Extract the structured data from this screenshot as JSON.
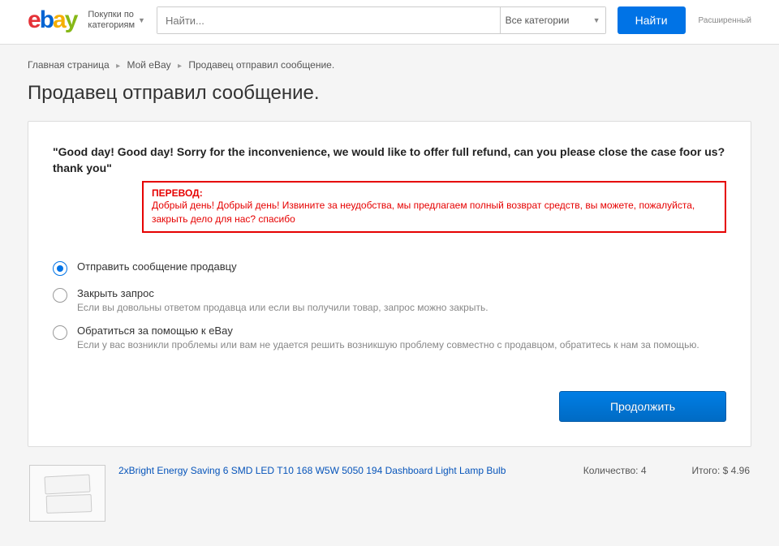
{
  "header": {
    "shop_by": "Покупки по\nкатегориям",
    "search_placeholder": "Найти...",
    "category_label": "Все категории",
    "search_button": "Найти",
    "advanced": "Расширенный"
  },
  "breadcrumb": {
    "home": "Главная страница",
    "my_ebay": "Мой eBay",
    "current": "Продавец отправил сообщение."
  },
  "page_title": "Продавец отправил сообщение.",
  "message": {
    "quote": "\"Good day! Good day! Sorry for the inconvenience, we would like to offer full refund, can you please close the case foor us? thank you\"",
    "translation_label": "ПЕРЕВОД:",
    "translation_text": "Добрый день! Добрый день! Извините за неудобства, мы предлагаем полный возврат средств, вы можете, пожалуйста, закрыть дело для нас? спасибо"
  },
  "options": [
    {
      "label": "Отправить сообщение продавцу",
      "desc": "",
      "checked": true
    },
    {
      "label": "Закрыть запрос",
      "desc": "Если вы довольны ответом продавца или если вы получили товар, запрос можно закрыть.",
      "checked": false
    },
    {
      "label": "Обратиться за помощью к eBay",
      "desc": "Если у вас возникли проблемы или вам не удается решить возникшую проблему совместно с продавцом, обратитесь к нам за помощью.",
      "checked": false
    }
  ],
  "continue_button": "Продолжить",
  "item": {
    "title": "2xBright Energy Saving 6 SMD LED T10 168 W5W 5050 194 Dashboard Light Lamp Bulb",
    "qty_label": "Количество: 4",
    "total_label": "Итого: $ 4.96"
  }
}
